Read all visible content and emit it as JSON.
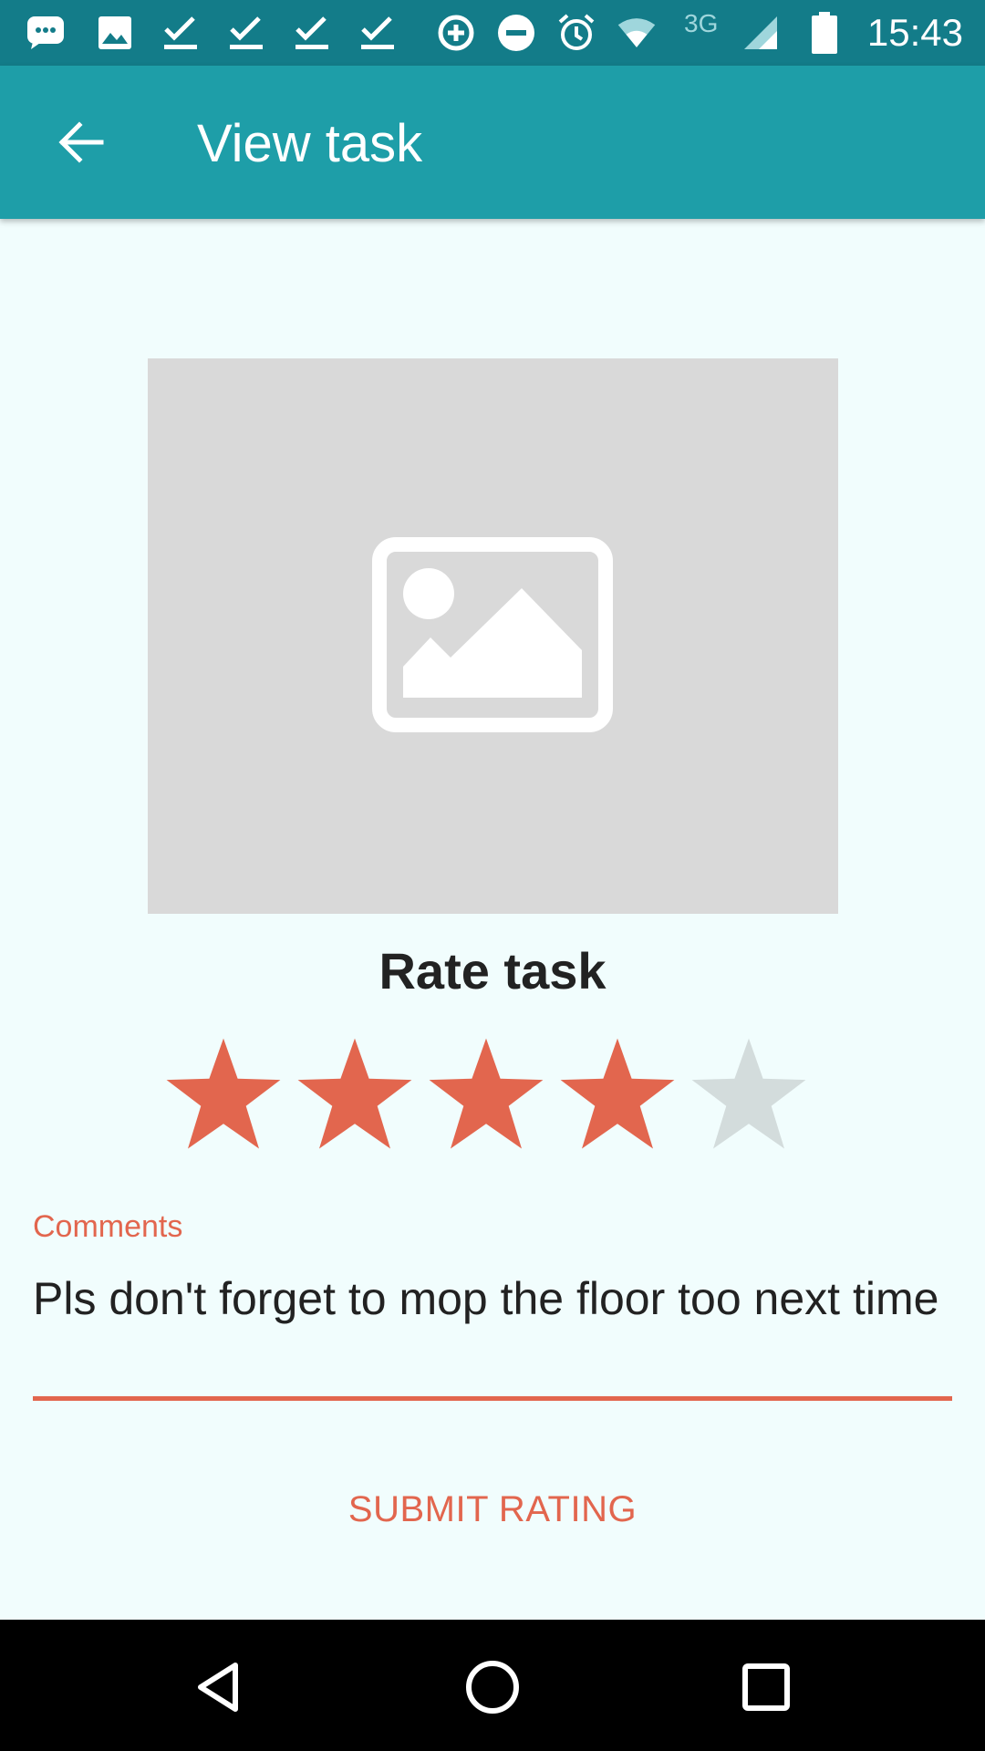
{
  "status_bar": {
    "time": "15:43",
    "network": "3G",
    "icons": [
      "message-icon",
      "image-icon",
      "check-icon",
      "check-icon",
      "check-icon",
      "check-icon",
      "data-saver-icon",
      "do-not-disturb-icon",
      "alarm-icon",
      "wifi-icon",
      "signal-icon",
      "battery-icon"
    ]
  },
  "app_bar": {
    "title": "View task",
    "back_icon": "arrow-back-icon",
    "color": "#1e9ea8"
  },
  "image": {
    "icon": "image-placeholder-icon"
  },
  "rating": {
    "title": "Rate task",
    "value": 4,
    "max": 5,
    "filled_color": "#e2664e",
    "empty_color": "#d3dcdc"
  },
  "comments": {
    "label": "Comments",
    "value": "Pls don't forget to mop the floor too next time"
  },
  "submit": {
    "label": "SUBMIT RATING"
  },
  "nav_bar": {
    "icons": [
      "back-nav-icon",
      "home-nav-icon",
      "recents-nav-icon"
    ]
  }
}
